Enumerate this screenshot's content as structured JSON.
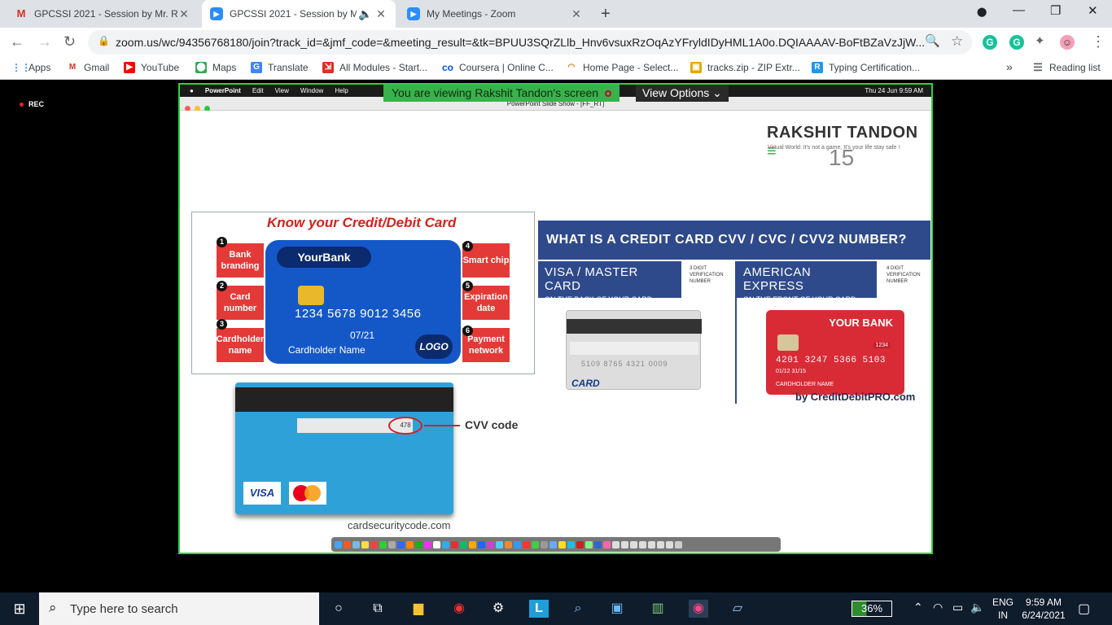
{
  "browser": {
    "tabs": [
      {
        "title": "GPCSSI 2021 - Session by Mr. Ra",
        "icon": "gmail-icon"
      },
      {
        "title": "GPCSSI 2021 - Session by M",
        "icon": "zoom-icon"
      },
      {
        "title": "My Meetings - Zoom",
        "icon": "zoom-icon"
      }
    ],
    "url": "zoom.us/wc/94356768180/join?track_id=&jmf_code=&meeting_result=&tk=BPUU3SQrZLlb_Hnv6vsuxRzOqAzYFryldIDyHML1A0o.DQIAAAAV-BoFtBZaVzJjW...",
    "bookmarks": [
      "Apps",
      "Gmail",
      "YouTube",
      "Maps",
      "Translate",
      "All Modules - Start...",
      "Coursera | Online C...",
      "Home Page - Select...",
      "tracks.zip - ZIP Extr...",
      "Typing Certification..."
    ],
    "bookmark_overflow": "»",
    "reading_list": "Reading list"
  },
  "meeting": {
    "rec_label": "REC",
    "share_banner": "You are viewing Rakshit Tandon's screen",
    "view_options": "View Options",
    "mac_menu": [
      "PowerPoint",
      "Edit",
      "View",
      "Window",
      "Help"
    ],
    "mac_clock": "Thu 24 Jun  9:59 AM",
    "ppt_window_title": "PowerPoint Slide Show - [FF_RT]"
  },
  "slide": {
    "brand": "RAKSHIT TANDON",
    "brand_tagline": "Virtual World: It's not a game, It's your life stay safe !",
    "slide_number": "15",
    "card_title": "Know your Credit/Debit Card",
    "labels": [
      {
        "n": "1",
        "text": "Bank branding"
      },
      {
        "n": "2",
        "text": "Card number"
      },
      {
        "n": "3",
        "text": "Cardholder name"
      },
      {
        "n": "4",
        "text": "Smart chip"
      },
      {
        "n": "5",
        "text": "Expiration date"
      },
      {
        "n": "6",
        "text": "Payment network"
      }
    ],
    "card_bank": "YourBank",
    "card_number": "1234 5678 9012 3456",
    "card_expiry": "07/21",
    "card_holder": "Cardholder Name",
    "card_logo": "LOGO",
    "cvv_heading": "WHAT IS A CREDIT CARD CVV / CVC / CVV2 NUMBER?",
    "visa_mc": "VISA / MASTER CARD",
    "visa_mc_sub": "ON THE BACK OF YOUR CARD",
    "amex": "AMERICAN EXPRESS",
    "amex_sub": "ON THE FRONT OF YOUR CARD",
    "three_digit": "3 DIGIT VERIFICATION NUMBER",
    "four_digit": "4 DIGIT VERIFICATION NUMBER",
    "back_card_word": "CARD",
    "back_card_numbers": "5109 8765 4321 0009",
    "amex_bank": "YOUR BANK",
    "amex_code": "1234",
    "amex_number": "4201 3247 5366 5103",
    "amex_dates": "01/12    31/15",
    "amex_holder": "CARDHOLDER NAME",
    "credit": "by CreditDebitPRO.com",
    "cvv_code_label": "CVV code",
    "cvv_value": "478",
    "visa": "VISA",
    "cardsec": "cardsecuritycode.com"
  },
  "taskbar": {
    "search_placeholder": "Type here to search",
    "battery": "36%",
    "lang": "ENG",
    "region": "IN",
    "time": "9:59 AM",
    "date": "6/24/2021"
  }
}
